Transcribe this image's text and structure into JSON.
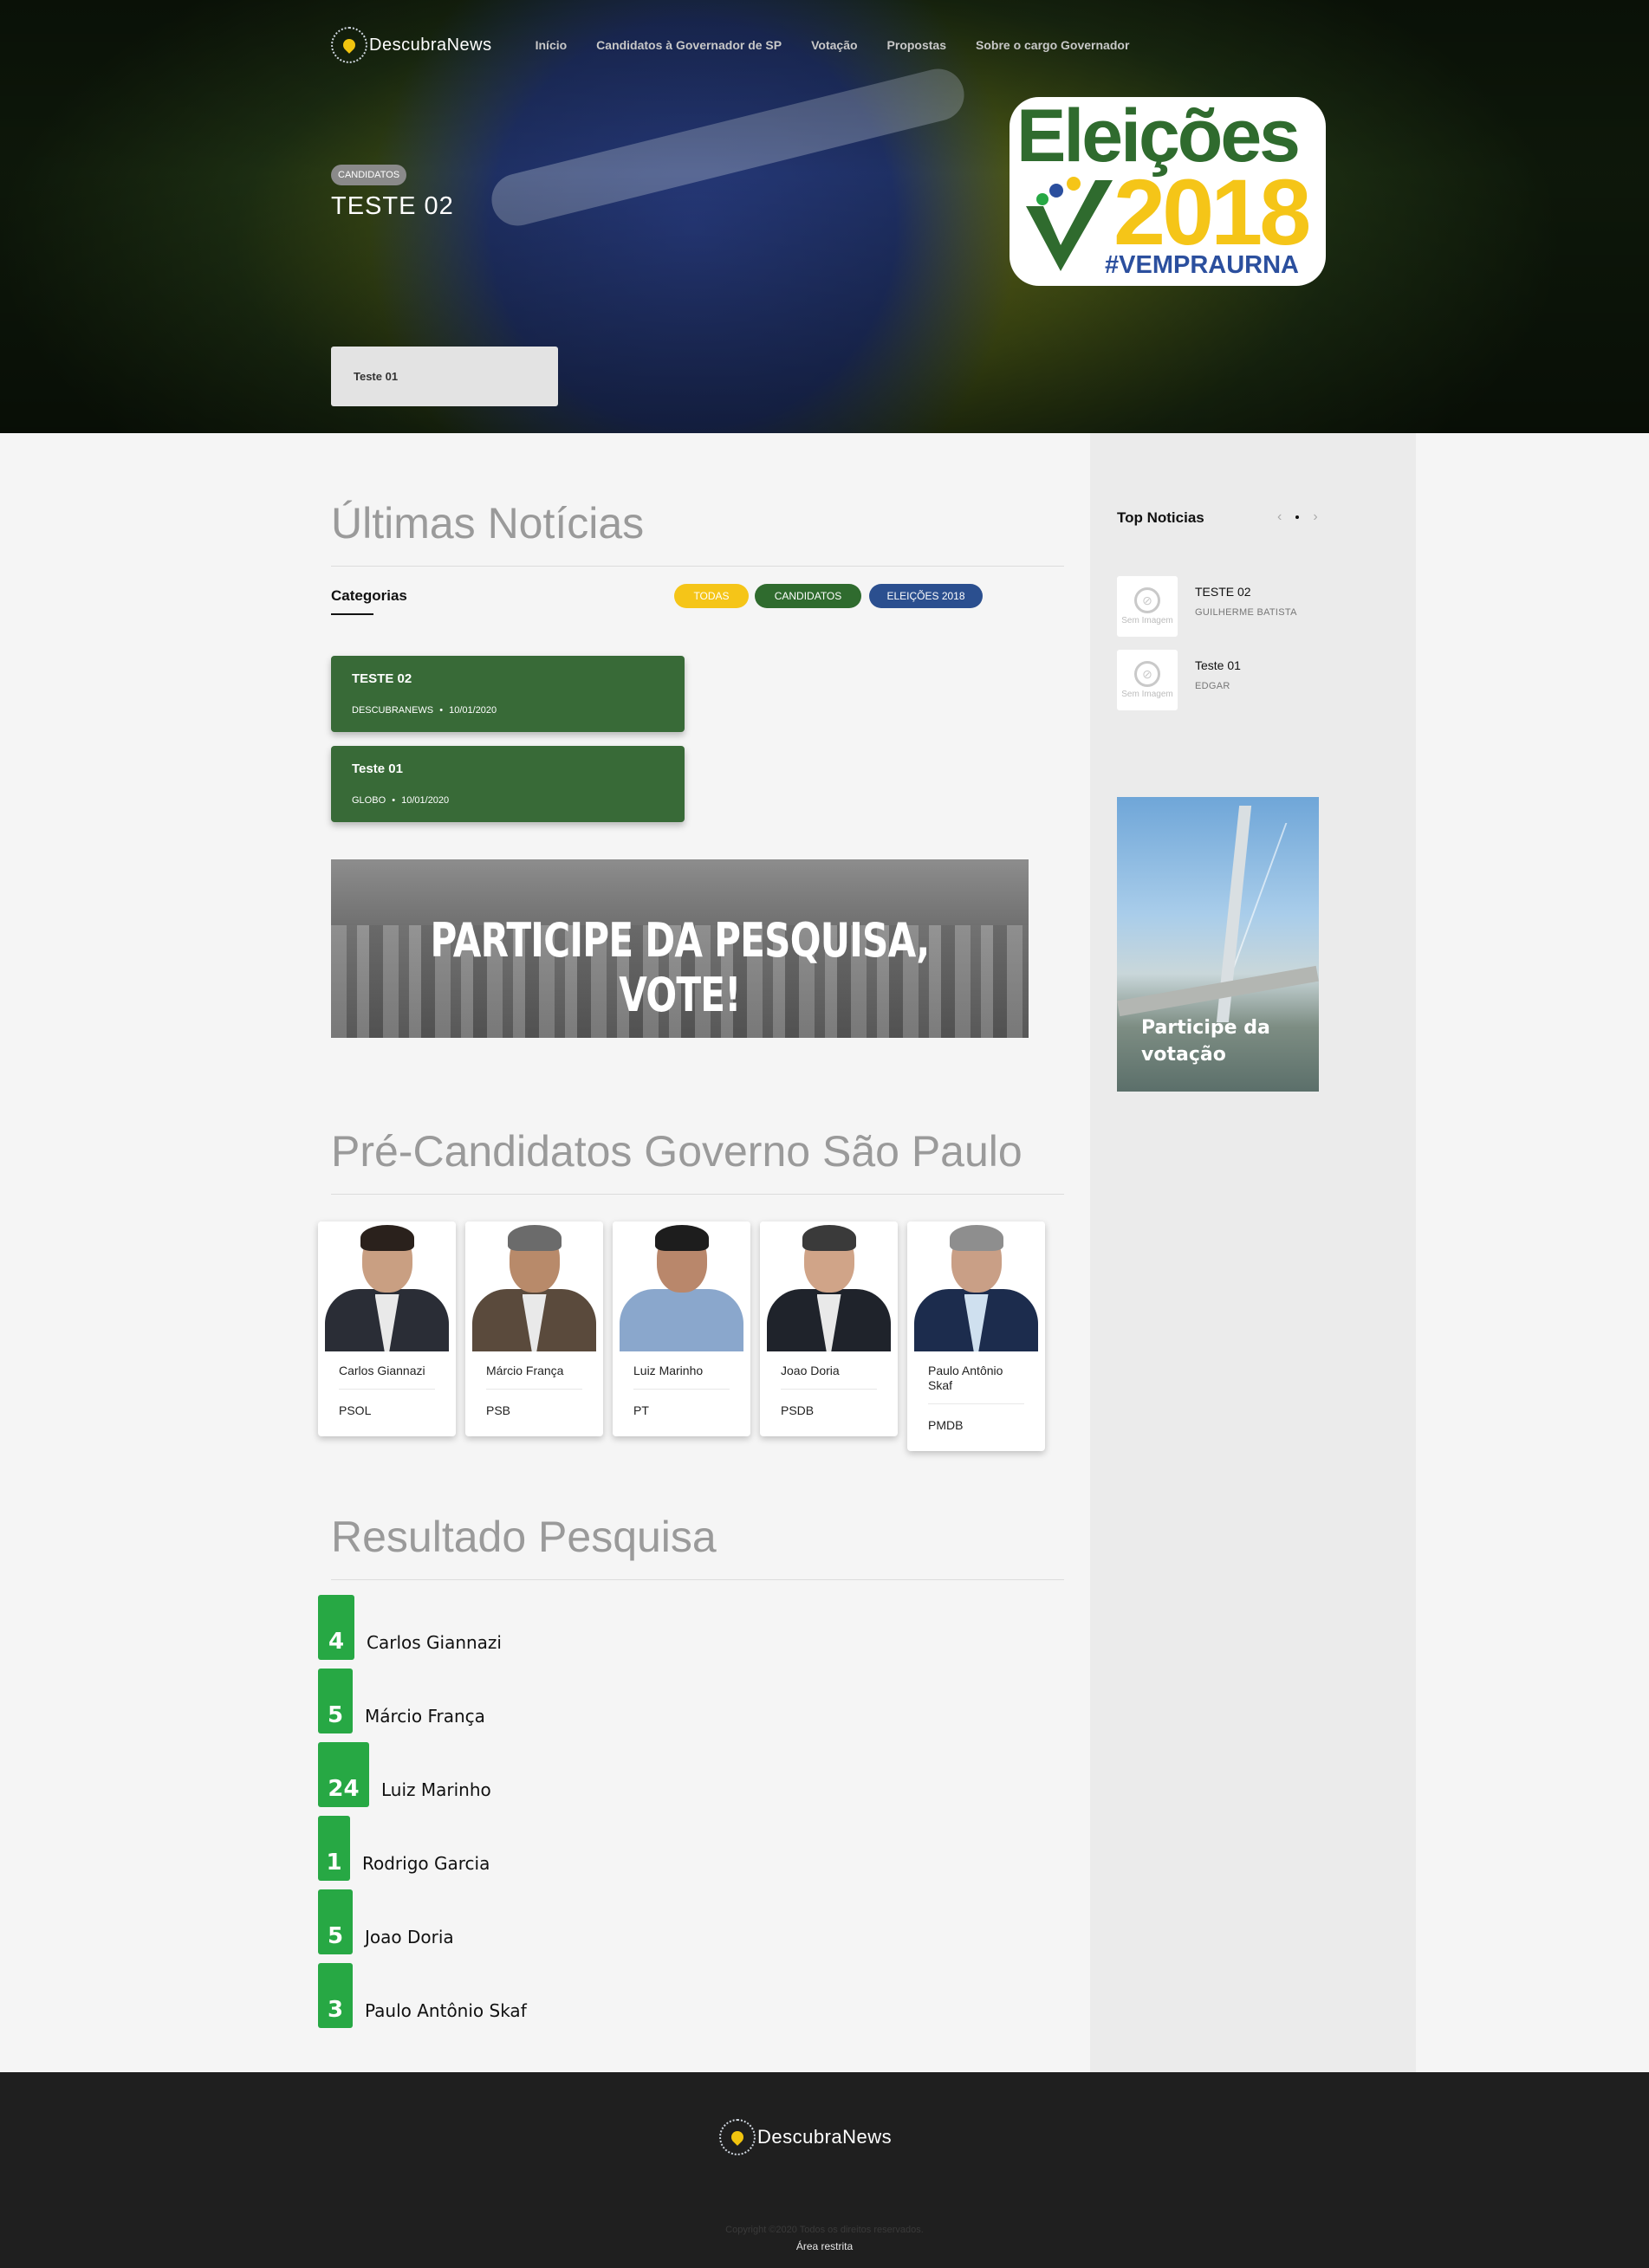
{
  "header": {
    "logo_text": "DescubraNews",
    "nav": [
      "Início",
      "Candidatos à Governador de SP",
      "Votação",
      "Propostas",
      "Sobre o cargo Governador"
    ]
  },
  "hero": {
    "badge": "CANDIDATOS",
    "title": "TESTE 02",
    "card_text": "Teste 01",
    "logo": {
      "line1": "Eleições",
      "line2": "2018",
      "line3": "#VEMPRAURNA"
    }
  },
  "news": {
    "section_title": "Últimas Notícias",
    "categories_label": "Categorias",
    "filters": [
      "TODAS",
      "CANDIDATOS",
      "ELEIÇÕES 2018"
    ],
    "items": [
      {
        "title": "TESTE 02",
        "source": "DESCUBRANEWS",
        "date": "10/01/2020"
      },
      {
        "title": "Teste 01",
        "source": "GLOBO",
        "date": "10/01/2020"
      }
    ],
    "meta_separator": "•"
  },
  "banner": {
    "text": "PARTICIPE DA PESQUISA, VOTE!"
  },
  "candidates": {
    "section_title": "Pré-Candidatos Governo São Paulo",
    "items": [
      {
        "name": "Carlos Giannazi",
        "party": "PSOL"
      },
      {
        "name": "Márcio França",
        "party": "PSB"
      },
      {
        "name": "Luiz Marinho",
        "party": "PT"
      },
      {
        "name": "Joao Doria",
        "party": "PSDB"
      },
      {
        "name": "Paulo Antônio Skaf",
        "party": "PMDB"
      }
    ]
  },
  "results": {
    "section_title": "Resultado Pesquisa",
    "items": [
      {
        "votes": 4,
        "name": "Carlos Giannazi"
      },
      {
        "votes": 5,
        "name": "Márcio França"
      },
      {
        "votes": 24,
        "name": "Luiz Marinho"
      },
      {
        "votes": 1,
        "name": "Rodrigo Garcia"
      },
      {
        "votes": 5,
        "name": "Joao Doria"
      },
      {
        "votes": 3,
        "name": "Paulo Antônio Skaf"
      }
    ]
  },
  "sidebar": {
    "top_title": "Top Noticias",
    "no_image": "Sem Imagem",
    "top_items": [
      {
        "title": "TESTE 02",
        "author": "GUILHERME BATISTA"
      },
      {
        "title": "Teste 01",
        "author": "EDGAR"
      }
    ],
    "banner_text": "Participe da votação"
  },
  "footer": {
    "logo_text": "DescubraNews",
    "copyright": "Copyright ©2020 Todos os direitos reservados.",
    "restricted": "Área restrita"
  },
  "colors": {
    "accent_green": "#386a37",
    "yellow": "#f5c518",
    "blue": "#2b4f8f",
    "result_green": "#27a844"
  }
}
